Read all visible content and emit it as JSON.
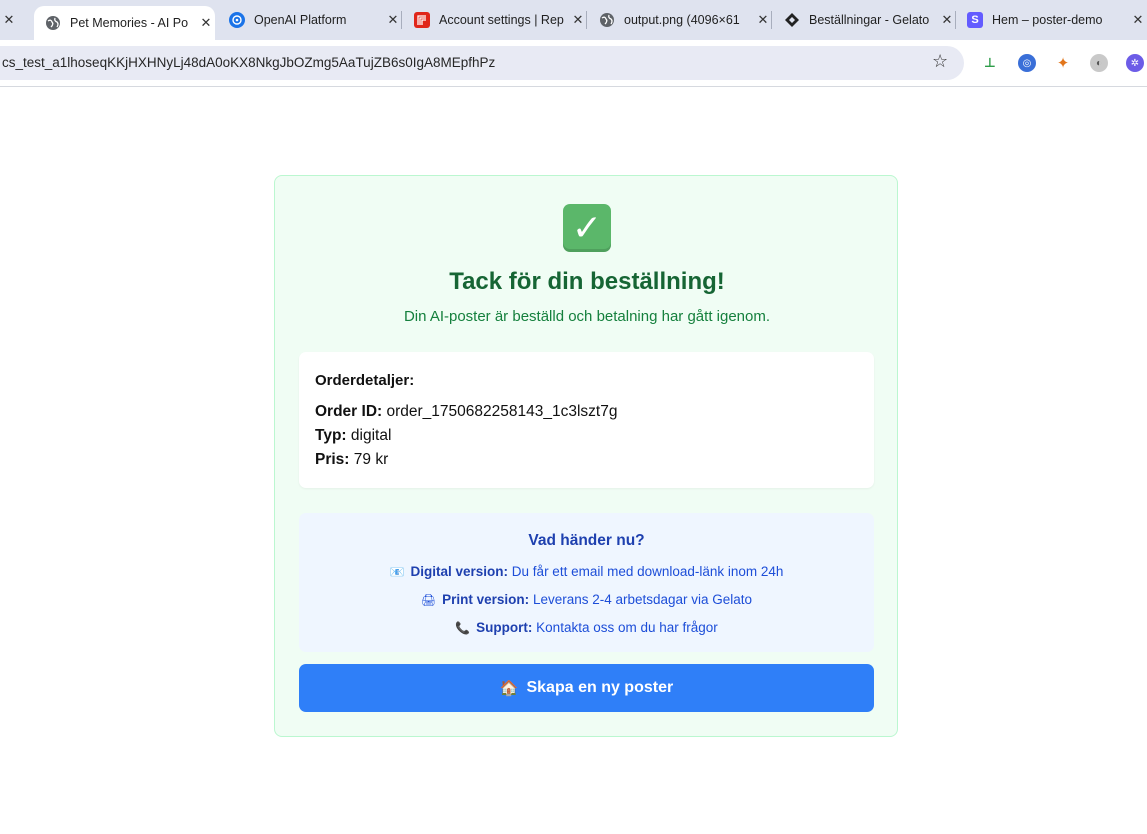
{
  "browser": {
    "tabs": [
      {
        "title": "",
        "icon": "close-icon",
        "closable": true
      },
      {
        "title": "Pet Memories - AI Po",
        "icon": "globe-icon",
        "active": true
      },
      {
        "title": "OpenAI Platform",
        "icon": "openai-icon"
      },
      {
        "title": "Account settings | Rep",
        "icon": "replicate-icon"
      },
      {
        "title": "output.png (4096×61",
        "icon": "globe-icon"
      },
      {
        "title": "Beställningar - Gelato",
        "icon": "gelato-icon"
      },
      {
        "title": "Hem – poster-demo",
        "icon": "stripe-icon"
      }
    ],
    "close_glyph": "✕",
    "url": "cs_test_a1lhoseqKKjHXHNyLj48dA0oKX8NkgJbOZmg5AaTujZB6s0IgA8MEpfhPz",
    "extensions": [
      "extension-1-icon",
      "extension-2-icon",
      "metamask-icon",
      "extension-4-icon",
      "extension-5-icon"
    ]
  },
  "page": {
    "title": "Tack för din beställning!",
    "subtitle": "Din AI-poster är beställd och betalning har gått igenom.",
    "details": {
      "heading": "Orderdetaljer:",
      "order_id_label": "Order ID:",
      "order_id": "order_1750682258143_1c3lszt7g",
      "type_label": "Typ:",
      "type": "digital",
      "price_label": "Pris:",
      "price": "79 kr"
    },
    "next": {
      "heading": "Vad händer nu?",
      "items": [
        {
          "icon": "email-icon",
          "label": "Digital version:",
          "text": "Du får ett email med download-länk inom 24h"
        },
        {
          "icon": "printer-icon",
          "label": "Print version:",
          "text": "Leverans 2-4 arbetsdagar via Gelato"
        },
        {
          "icon": "phone-icon",
          "label": "Support:",
          "text": "Kontakta oss om du har frågor"
        }
      ]
    },
    "cta_label": "Skapa en ny poster",
    "cta_icon": "house-icon"
  },
  "colors": {
    "card_bg": "#f0fdf4",
    "title": "#166534",
    "info_bg": "#eff6ff",
    "cta": "#2f7ff8"
  }
}
